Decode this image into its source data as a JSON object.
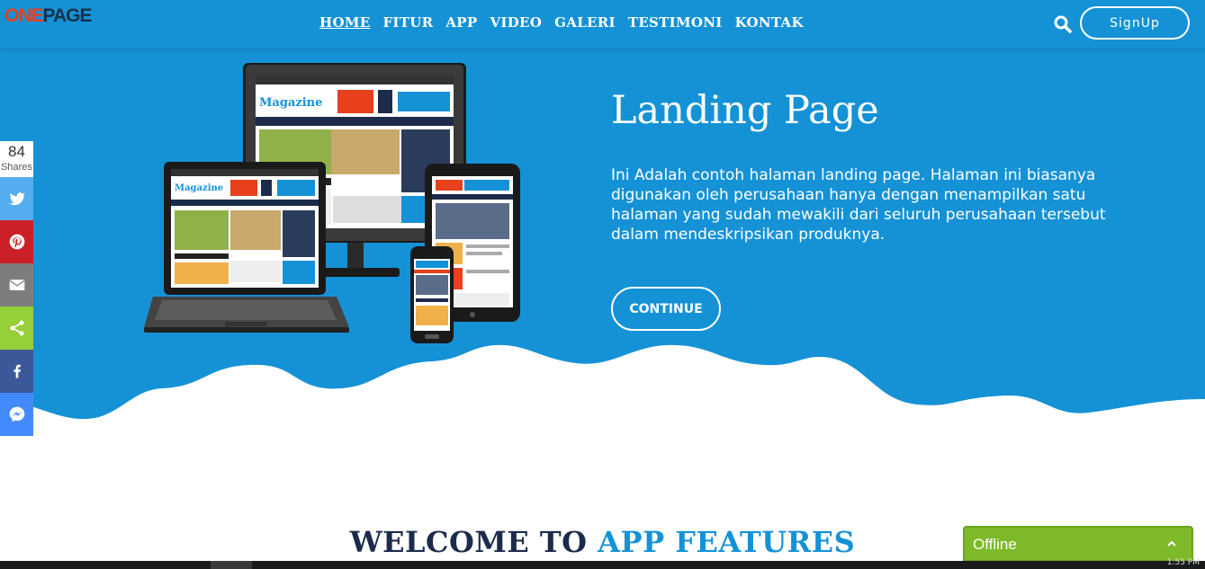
{
  "header": {
    "logo_part1": "ONE",
    "logo_part2": "PAGE",
    "nav": [
      "HOME",
      "FITUR",
      "APP",
      "VIDEO",
      "GALERI",
      "TESTIMONI",
      "KONTAK"
    ],
    "signup_label": "SignUp"
  },
  "hero": {
    "title": "Landing Page",
    "description": "Ini Adalah contoh halaman landing page. Halaman ini biasanya digunakan oleh perusahaan hanya dengan menampilkan satu halaman yang sudah mewakili dari seluruh perusahaan tersebut dalam mendeskripsikan produknya.",
    "cta_label": "CONTINUE",
    "mockup_brand": "Magazine"
  },
  "share": {
    "count": "84",
    "count_label": "Shares",
    "buttons": [
      {
        "name": "twitter",
        "color": "#55acee"
      },
      {
        "name": "pinterest",
        "color": "#cb2027"
      },
      {
        "name": "email",
        "color": "#7d7d7d"
      },
      {
        "name": "sharethis",
        "color": "#95d03a"
      },
      {
        "name": "facebook",
        "color": "#3b5998"
      },
      {
        "name": "messenger",
        "color": "#448aff"
      }
    ]
  },
  "welcome": {
    "part1": "WELCOME TO ",
    "part2": "APP FEATURES"
  },
  "chat": {
    "status_label": "Offline"
  },
  "taskbar": {
    "time": "1:55 PM"
  },
  "colors": {
    "primary": "#1592d6",
    "logo_accent": "#e8401c",
    "heading_dark": "#1c2b4a",
    "chat_green": "#7db928"
  }
}
